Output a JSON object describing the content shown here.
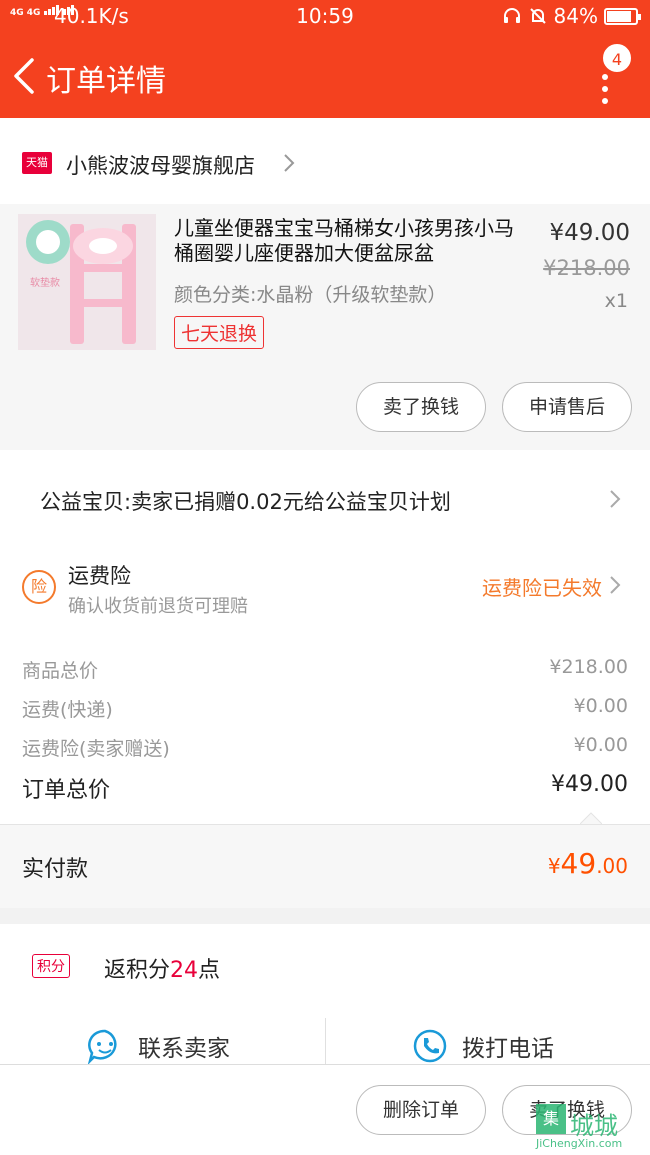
{
  "status_bar": {
    "network": "4G 4G",
    "speed": "40.1K/s",
    "time": "10:59",
    "battery": "84%"
  },
  "nav": {
    "title": "订单详情",
    "badge_count": "4"
  },
  "shop": {
    "badge_text": "天猫",
    "name": "小熊波波母婴旗舰店"
  },
  "product": {
    "title": "儿童坐便器宝宝马桶梯女小孩男孩小马桶圈婴儿座便器加大便盆尿盆",
    "sku": "颜色分类:水晶粉（升级软垫款）",
    "tag": "七天退换",
    "price": "¥49.00",
    "original_price": "¥218.00",
    "quantity": "x1",
    "thumb_label": "软垫款",
    "buttons": {
      "resell": "卖了换钱",
      "after_sale": "申请售后"
    }
  },
  "charity": {
    "text": "公益宝贝:卖家已捐赠0.02元给公益宝贝计划"
  },
  "insurance": {
    "icon_text": "险",
    "title": "运费险",
    "subtitle": "确认收货前退货可理赔",
    "status": "运费险已失效"
  },
  "summary": {
    "items": [
      {
        "label": "商品总价",
        "value": "¥218.00"
      },
      {
        "label": "运费(快递)",
        "value": "¥0.00"
      },
      {
        "label": "运费险(卖家赠送)",
        "value": "¥0.00"
      }
    ],
    "total_label": "订单总价",
    "total_value": "¥49.00"
  },
  "paid": {
    "label": "实付款",
    "currency": "¥",
    "integer": "49",
    "decimal": ".00"
  },
  "points": {
    "tag": "积分",
    "prefix": "返积分",
    "amount": "24",
    "suffix": "点"
  },
  "contact": {
    "seller": "联系卖家",
    "call": "拨打电话"
  },
  "footer": {
    "delete_order": "删除订单",
    "resell": "卖了换钱"
  },
  "watermark": {
    "box": "集",
    "cn": "城城",
    "en": "JiChengXin.com"
  },
  "colors": {
    "brand": "#f4411f",
    "accent": "#ff5000",
    "tmall": "#e8003a",
    "insurance": "#f47a2c",
    "service_blue": "#1a9ad8"
  }
}
